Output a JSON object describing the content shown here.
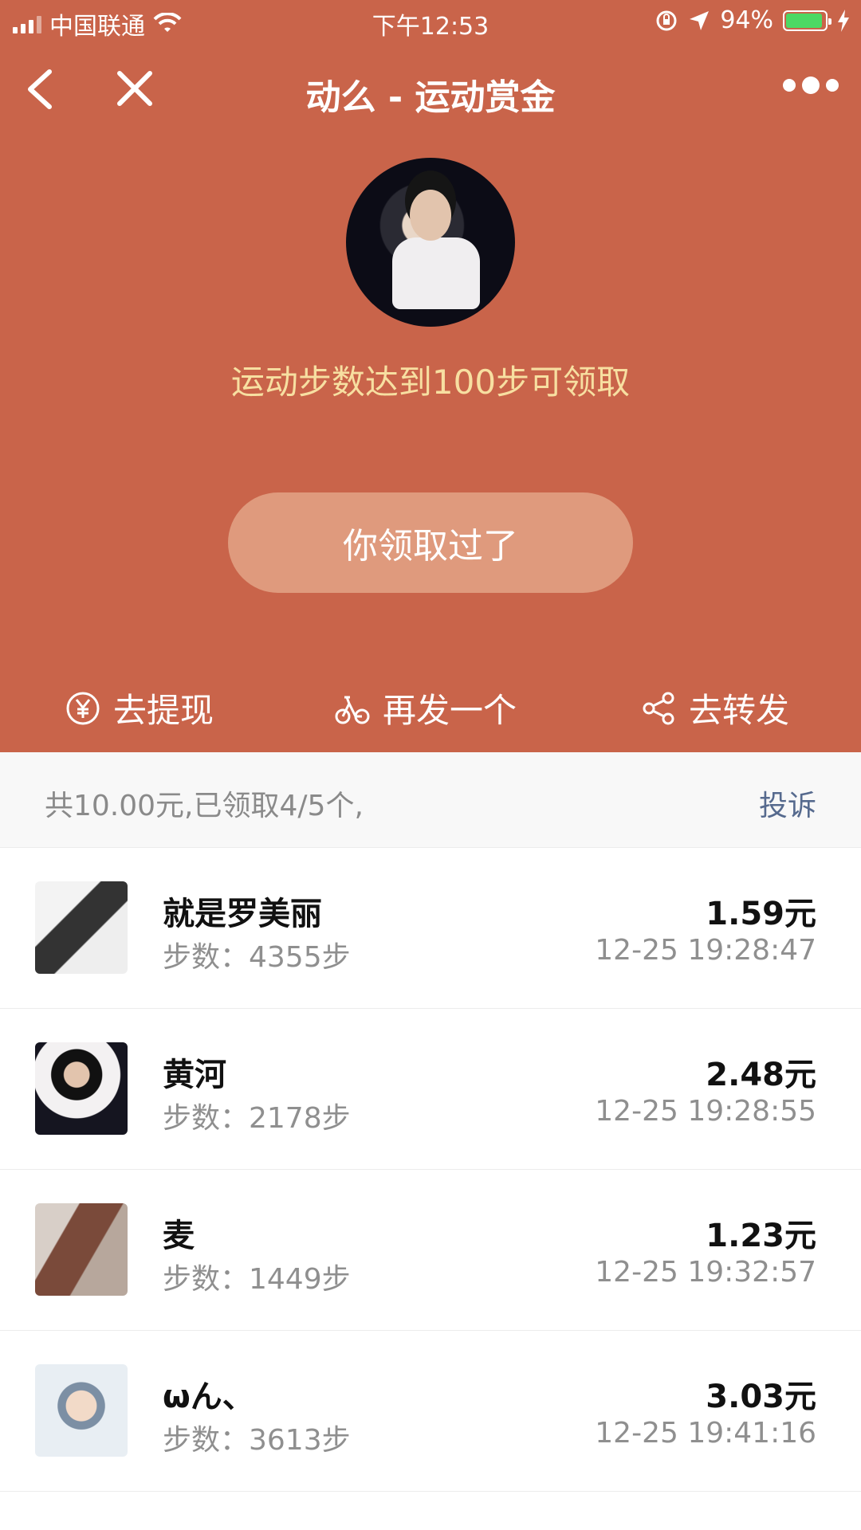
{
  "status_bar": {
    "carrier": "中国联通",
    "time": "下午12:53",
    "battery_percent": "94%",
    "battery_level": 0.94,
    "colors": {
      "battery_fill": "#4cd964"
    }
  },
  "nav": {
    "title": "动么 - 运动赏金"
  },
  "hero": {
    "subtitle": "运动步数达到100步可领取",
    "claimed_button": "你领取过了",
    "actions": {
      "withdraw": "去提现",
      "send_again": "再发一个",
      "forward": "去转发"
    },
    "colors": {
      "background": "#c9644a",
      "subtitle": "#f7dfa1",
      "button": "#df9a7d"
    }
  },
  "summary": {
    "text": "共10.00元,已领取4/5个,",
    "complain": "投诉"
  },
  "list": [
    {
      "name": "就是罗美丽",
      "steps": "步数：4355步",
      "amount": "1.59元",
      "time": "12-25 19:28:47"
    },
    {
      "name": "黄河",
      "steps": "步数：2178步",
      "amount": "2.48元",
      "time": "12-25 19:28:55"
    },
    {
      "name": "麦",
      "steps": "步数：1449步",
      "amount": "1.23元",
      "time": "12-25 19:32:57"
    },
    {
      "name": "ωん、",
      "steps": "步数：3613步",
      "amount": "3.03元",
      "time": "12-25 19:41:16"
    }
  ]
}
